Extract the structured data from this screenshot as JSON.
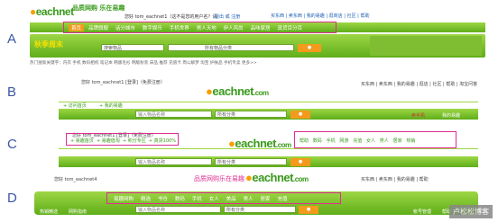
{
  "labels": [
    "A",
    "B",
    "C",
    "D"
  ],
  "a": {
    "slogan": "品质网购 乐在易趣",
    "logo": "eachnet",
    "welcome": "您好 tom_eachnet1（这不是您的用户名？请",
    "exit": "退出 或 注册",
    "top": [
      "买东西",
      "卖东西",
      "我的易趣",
      "逛商店",
      "社区",
      "帮助"
    ],
    "tabs": [
      "首页",
      "品牌旗舰",
      "话分城市",
      "数字娱乐",
      "手机世界",
      "男人天地",
      "伊人风尚",
      "品味家居",
      "真货百分百"
    ],
    "promo": "秋季周末",
    "search_ph": "搜索物品",
    "cat": "所有物品分类",
    "hot": "热门搜索关键字：内衣 手机 数码相机 笔记本 韩版毛衫 韩版秋装 床品 推荐 充值卡 周公解梦 淘宝 护肤品 手机专卖 更多>>"
  },
  "b": {
    "welcome": "您好 tom_eachnet1 [登录]（免费注册）",
    "top": "买东西 | 卖东西 | 我的易趣 | 逛店 | 社区 | 帮助 | 淘宝问答",
    "logo": "eachnet",
    "c": ".com",
    "nav": [
      "+ 访问首页",
      "+ 我的易趣"
    ],
    "search_ph": "输入物品名称",
    "cat": "所有分类",
    "right": [
      "卖手机",
      "我的易趣"
    ]
  },
  "c": {
    "welcome": "您好 tom_eachnet1 [登录]（免费注册）",
    "links": [
      "+ 易趣首页",
      "+ 易趣值淘",
      "+ 积分专区",
      "+ 真货100%"
    ],
    "tabs": [
      "帮助",
      "数码",
      "手机",
      "网游",
      "充值",
      "女人",
      "男人",
      "居家",
      "热销"
    ],
    "search_ph": "输入物品名称",
    "cat": "所有分类"
  },
  "d": {
    "slogan": "品质网购乐在易趣",
    "welcome": "您好 tom_eachnet4",
    "menu": [
      "买东西",
      "卖东西",
      "我的易趣",
      "帮助"
    ],
    "tabs": [
      "易趣网购",
      "精选",
      "书仓",
      "数码",
      "手机",
      "女人",
      "美品",
      "男人",
      "居家",
      "充值"
    ],
    "search_ph": "输入物品名称",
    "cat": "所有分类",
    "buttons": [
      "热销精选",
      "网购指南",
      "帐号管理",
      "帮助中心"
    ]
  },
  "watermark": "卢松松博客"
}
